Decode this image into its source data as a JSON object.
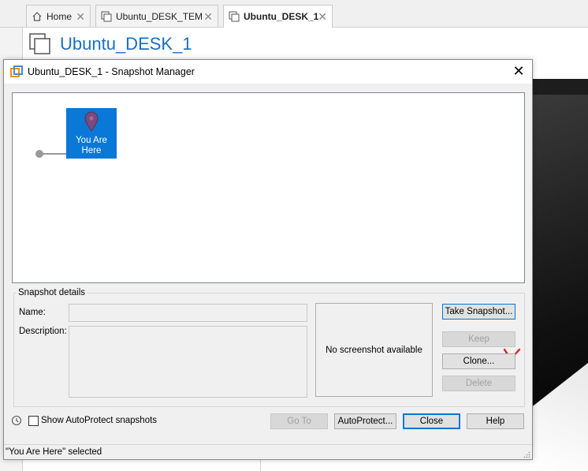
{
  "tabs": [
    {
      "label": "Home",
      "icon": "home-icon"
    },
    {
      "label": "Ubuntu_DESK_TEM",
      "icon": "vm-icon"
    },
    {
      "label": "Ubuntu_DESK_1",
      "icon": "vm-icon",
      "active": true
    }
  ],
  "vm": {
    "title": "Ubuntu_DESK_1",
    "title_color": "#1a6fc0"
  },
  "dialog": {
    "title": "Ubuntu_DESK_1 - Snapshot Manager",
    "close_glyph": "✕",
    "tree": {
      "you_are_here": "You Are\nHere",
      "node_color": "#0a78d7"
    },
    "details": {
      "group_label": "Snapshot details",
      "name_label": "Name:",
      "name_value": "",
      "description_label": "Description:",
      "description_value": "",
      "no_screenshot": "No screenshot available"
    },
    "buttons": {
      "take_snapshot": "Take Snapshot...",
      "keep": "Keep",
      "clone": "Clone...",
      "delete": "Delete",
      "goto": "Go To",
      "autoprotect": "AutoProtect...",
      "close": "Close",
      "help": "Help"
    },
    "show_autoprotect_label": "Show AutoProtect snapshots",
    "show_autoprotect_checked": false,
    "status": "\"You Are Here\" selected"
  },
  "colors": {
    "accent": "#0078d7",
    "annotation": "#e02020"
  }
}
